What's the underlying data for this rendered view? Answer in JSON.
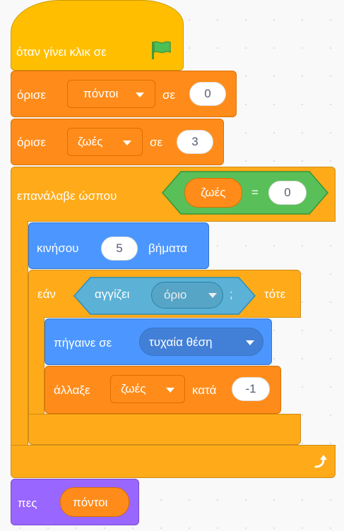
{
  "hat": {
    "label": "όταν γίνει κλικ σε",
    "icon": "green-flag-icon"
  },
  "set_score": {
    "label": "όρισε",
    "variable": "πόντοι",
    "to_label": "σε",
    "value": "0"
  },
  "set_lives": {
    "label": "όρισε",
    "variable": "ζωές",
    "to_label": "σε",
    "value": "3"
  },
  "repeat_until": {
    "label": "επανάλαβε ώσπου",
    "condition": {
      "left_reporter": "ζωές",
      "operator": "=",
      "right_value": "0"
    },
    "loop_icon": "loop-arrow-icon"
  },
  "move": {
    "label": "κινήσου",
    "value": "5",
    "suffix": "βήματα"
  },
  "if_block": {
    "label": "εάν",
    "condition": {
      "label": "αγγίζει",
      "option": "όριο",
      "suffix": ";"
    },
    "then_label": "τότε"
  },
  "goto": {
    "label": "πήγαινε σε",
    "option": "τυχαία θέση"
  },
  "change": {
    "label": "άλλαξε",
    "variable": "ζωές",
    "by_label": "κατά",
    "value": "-1"
  },
  "say": {
    "label": "πες",
    "reporter": "πόντοι"
  },
  "colors": {
    "events": "#ffbf00",
    "variables": "#ff8c1a",
    "control": "#ffab19",
    "motion": "#4c97ff",
    "sensing": "#5cb1d6",
    "operators": "#59c059",
    "looks": "#9966ff"
  }
}
